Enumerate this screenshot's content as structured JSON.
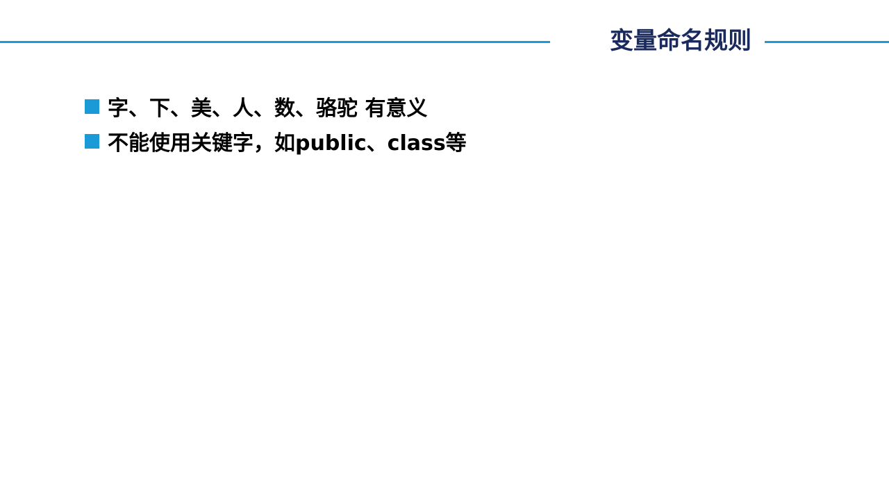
{
  "slide": {
    "title": "变量命名规则",
    "accent_color": "#1b9ad8",
    "title_color": "#1a2a5c",
    "bullets": [
      {
        "text": "字、下、美、人、数、骆驼  有意义"
      },
      {
        "text": "不能使用关键字，如public、class等"
      }
    ]
  }
}
